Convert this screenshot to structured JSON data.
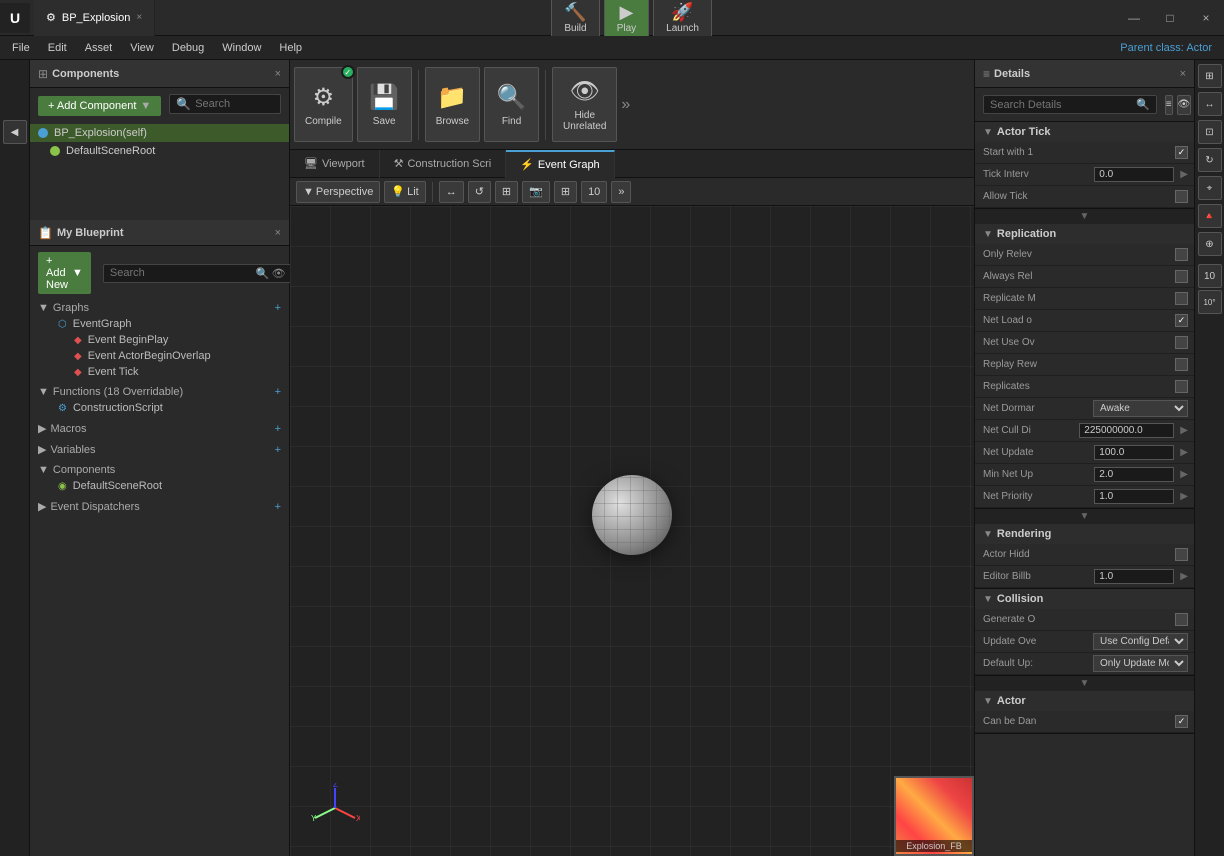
{
  "window": {
    "title": "BP_Explosion",
    "tab_label": "BP_Explosion",
    "close_label": "×",
    "min_label": "—",
    "max_label": "□"
  },
  "menu": {
    "items": [
      "File",
      "Edit",
      "Asset",
      "View",
      "Debug",
      "Window",
      "Help"
    ],
    "parent_class_label": "Parent class:",
    "parent_class_value": "Actor"
  },
  "toolbar": {
    "compile_label": "Compile",
    "save_label": "Save",
    "browse_label": "Browse",
    "find_label": "Find",
    "hide_unrelated_label": "Hide\nUnrelated"
  },
  "editor_tabs": {
    "viewport_label": "Viewport",
    "construction_label": "Construction Scri",
    "event_label": "Event Graph"
  },
  "viewport_toolbar": {
    "perspective_label": "Perspective",
    "lit_label": "Lit",
    "grid_num": "10",
    "more_label": "»"
  },
  "components": {
    "section_title": "Components",
    "add_component_label": "+ Add Component",
    "search_placeholder": "Search",
    "bp_explosion_label": "BP_Explosion(self)",
    "default_scene_root_label": "DefaultSceneRoot",
    "default_scene_root2_label": "DefaultSceneRoot"
  },
  "my_blueprint": {
    "title": "My Blueprint",
    "add_new_label": "+ Add New",
    "search_placeholder": "Search",
    "graphs_label": "Graphs",
    "event_graph_label": "EventGraph",
    "event_begin_play_label": "Event BeginPlay",
    "event_actor_overlap_label": "Event ActorBeginOverlap",
    "event_tick_label": "Event Tick",
    "functions_label": "Functions (18 Overridable)",
    "construction_script_label": "ConstructionScript",
    "macros_label": "Macros",
    "variables_label": "Variables",
    "components_label": "Components",
    "default_scene_root_label": "DefaultSceneRoot",
    "event_dispatchers_label": "Event Dispatchers"
  },
  "details": {
    "title": "Details",
    "search_placeholder": "Search Details",
    "actor_tick_label": "Actor Tick",
    "start_with_1_label": "Start with 1",
    "start_with_1_checked": true,
    "tick_interval_label": "Tick Interv",
    "tick_interval_value": "0.0",
    "allow_tick_label": "Allow Tick",
    "allow_tick_checked": false,
    "replication_label": "Replication",
    "only_relevant_label": "Only Relev",
    "only_relevant_checked": false,
    "always_relevant_label": "Always Rel",
    "always_relevant_checked": false,
    "replicate_movement_label": "Replicate M",
    "replicate_movement_checked": false,
    "net_load_on_label": "Net Load o",
    "net_load_on_checked": true,
    "net_use_owner_label": "Net Use Ov",
    "net_use_owner_checked": false,
    "replay_rewind_label": "Replay Rew",
    "replay_rewind_checked": false,
    "replicates_label": "Replicates",
    "replicates_checked": false,
    "net_dormancy_label": "Net Dormar",
    "net_dormancy_value": "Awake",
    "net_cull_label": "Net Cull Di",
    "net_cull_value": "225000000.0",
    "net_update_label": "Net Update",
    "net_update_value": "100.0",
    "min_net_update_label": "Min Net Up",
    "min_net_update_value": "2.0",
    "net_priority_label": "Net Priority",
    "net_priority_value": "1.0",
    "rendering_label": "Rendering",
    "actor_hidden_label": "Actor Hidd",
    "actor_hidden_checked": false,
    "editor_billboard_label": "Editor Billb",
    "editor_billboard_value": "1.0",
    "collision_label": "Collision",
    "generate_overlap_label": "Generate O",
    "generate_overlap_checked": false,
    "update_overlaps_label": "Update Ove",
    "update_overlaps_value": "Use Config Defau",
    "default_update_label": "Default Up:",
    "default_update_value": "Only Update Mov",
    "actor_section_label": "Actor",
    "can_be_damaged_label": "Can be Dan",
    "can_be_damaged_checked": true
  },
  "thumbnail": {
    "label": "Explosion_FB"
  },
  "right_toolbar": {
    "build_label": "Build",
    "play_label": "Play",
    "launch_label": "Launch"
  },
  "main_toolbar": {
    "grid_size": "10",
    "angle": "10°"
  }
}
